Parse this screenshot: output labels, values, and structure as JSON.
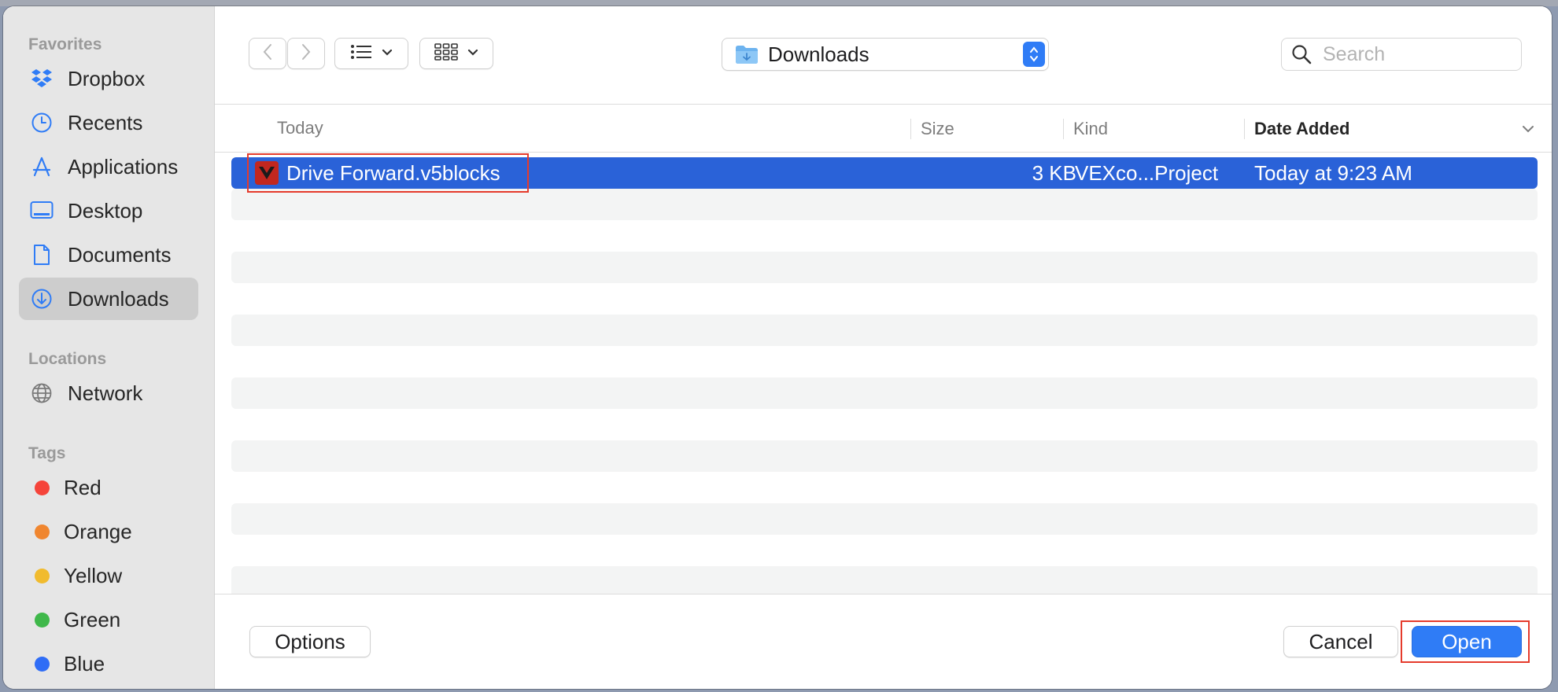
{
  "sidebar": {
    "favorites_title": "Favorites",
    "favorites": [
      {
        "label": "Dropbox",
        "icon": "dropbox-icon"
      },
      {
        "label": "Recents",
        "icon": "clock-icon"
      },
      {
        "label": "Applications",
        "icon": "applications-icon"
      },
      {
        "label": "Desktop",
        "icon": "desktop-icon"
      },
      {
        "label": "Documents",
        "icon": "document-icon"
      },
      {
        "label": "Downloads",
        "icon": "download-icon",
        "selected": true
      }
    ],
    "locations_title": "Locations",
    "locations": [
      {
        "label": "Network",
        "icon": "globe-icon"
      }
    ],
    "tags_title": "Tags",
    "tags": [
      {
        "label": "Red",
        "color": "#f5443a"
      },
      {
        "label": "Orange",
        "color": "#f0862f"
      },
      {
        "label": "Yellow",
        "color": "#f1bb2e"
      },
      {
        "label": "Green",
        "color": "#3fb84a"
      },
      {
        "label": "Blue",
        "color": "#2f6df6"
      }
    ]
  },
  "toolbar": {
    "current_folder": "Downloads",
    "search_placeholder": "Search",
    "search_value": ""
  },
  "columns": {
    "name": "Today",
    "size": "Size",
    "kind": "Kind",
    "date_added": "Date Added"
  },
  "files": [
    {
      "name": "Drive Forward.v5blocks",
      "size": "3 KB",
      "kind": "VEXco...Project",
      "date_added": "Today at 9:23 AM",
      "selected": true
    }
  ],
  "buttons": {
    "options": "Options",
    "cancel": "Cancel",
    "open": "Open"
  },
  "colors": {
    "accent": "#2f7cf6",
    "selection": "#2a62d8",
    "annotation": "#e53b2c"
  }
}
